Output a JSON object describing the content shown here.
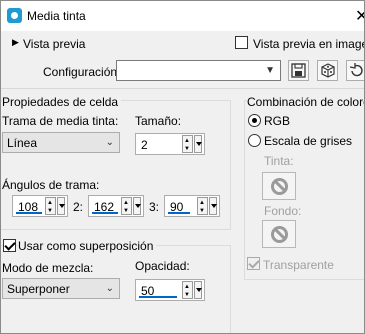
{
  "window": {
    "title": "Media tinta",
    "close": "✕"
  },
  "top": {
    "preview_label": "Vista previa",
    "preview_in_image_label": "Vista previa en imagen",
    "preview_in_image_checked": false,
    "config_label": "Configuración",
    "config_value": ""
  },
  "cell": {
    "group_label": "Propiedades de celda",
    "pattern_label": "Trama de media tinta:",
    "pattern_value": "Línea",
    "size_label": "Tamaño:",
    "size_value": "2",
    "angles_label": "Ángulos de trama:",
    "angle1": "108",
    "angle2_label": "2:",
    "angle2": "162",
    "angle3_label": "3:",
    "angle3": "90"
  },
  "overlay": {
    "checkbox_label": "Usar como superposición",
    "checked": true,
    "blend_label": "Modo de mezcla:",
    "blend_value": "Superponer",
    "opacity_label": "Opacidad:",
    "opacity_value": "50"
  },
  "color": {
    "group_label": "Combinación de colores",
    "rgb_label": "RGB",
    "gray_label": "Escala de grises",
    "selected": "RGB",
    "tint_label": "Tinta:",
    "bg_label": "Fondo:",
    "transparent_label": "Transparente",
    "transparent_checked": true
  }
}
